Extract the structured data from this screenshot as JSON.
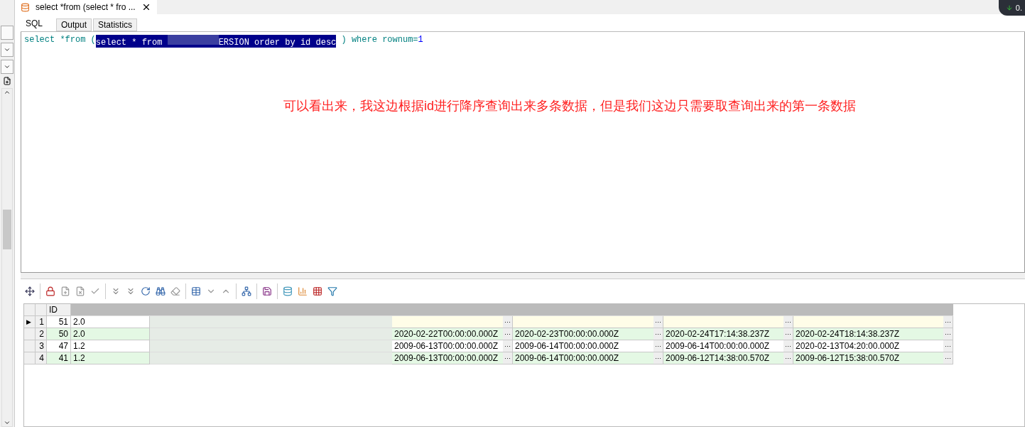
{
  "editor_tab": {
    "title": "select *from (select * fro ..."
  },
  "badge": {
    "text": "0."
  },
  "tabs": [
    {
      "label": "SQL",
      "selected": true
    },
    {
      "label": "Output",
      "selected": false
    },
    {
      "label": "Statistics",
      "selected": false
    }
  ],
  "sql": {
    "before": "select *from (",
    "selected_start": "select * from ",
    "selected_end": "ERSION order by id desc",
    "after_paren": " )",
    "keyword": "where",
    "condition": "rownum=",
    "number": "1"
  },
  "annotation": "可以看出来，我这边根据id进行降序查询出来多条数据，但是我们这边只需要取查询出来的第一条数据",
  "grid": {
    "id_header": "ID",
    "ellipsis": "···",
    "rows": [
      {
        "num": "1",
        "id": "51",
        "version": "2.0",
        "indicator": "▶"
      },
      {
        "num": "2",
        "id": "50",
        "version": "2.0",
        "dates": [
          "2020-02-22T00:00:00.000Z",
          "2020-02-23T00:00:00.000Z",
          "2020-02-24T17:14:38.237Z",
          "2020-02-24T18:14:38.237Z"
        ]
      },
      {
        "num": "3",
        "id": "47",
        "version": "1.2",
        "dates": [
          "2009-06-13T00:00:00.000Z",
          "2009-06-14T00:00:00.000Z",
          "2009-06-14T00:00:00.000Z",
          "2020-02-13T04:20:00.000Z"
        ]
      },
      {
        "num": "4",
        "id": "41",
        "version": "1.2",
        "dates": [
          "2009-06-13T00:00:00.000Z",
          "2009-06-14T00:00:00.000Z",
          "2009-06-12T14:38:00.570Z",
          "2009-06-12T15:38:00.570Z"
        ]
      }
    ]
  }
}
